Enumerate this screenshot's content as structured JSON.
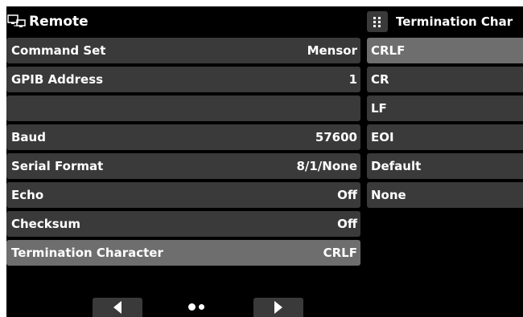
{
  "header": {
    "title": "Remote",
    "icon": "remote-computers-icon"
  },
  "settings": [
    {
      "label": "Command Set",
      "value": "Mensor"
    },
    {
      "label": "GPIB Address",
      "value": "1"
    },
    {
      "label": "",
      "value": ""
    },
    {
      "label": "Baud",
      "value": "57600"
    },
    {
      "label": "Serial Format",
      "value": "8/1/None"
    },
    {
      "label": "Echo",
      "value": "Off"
    },
    {
      "label": "Checksum",
      "value": "Off"
    },
    {
      "label": "Termination Character",
      "value": "CRLF"
    }
  ],
  "selected_setting": "Termination Character",
  "panel": {
    "title": "Termination Char",
    "icon": "grid-menu-icon",
    "options": [
      "CRLF",
      "CR",
      "LF",
      "EOI",
      "Default",
      "None"
    ],
    "selected": "CRLF"
  },
  "pager": {
    "prev_icon": "left-arrow-icon",
    "next_icon": "right-arrow-icon",
    "page": 1,
    "pages": 2
  },
  "colors": {
    "background": "#000000",
    "row": "#3a3a3a",
    "row_selected": "#6e6e6e",
    "text": "#ffffff"
  }
}
